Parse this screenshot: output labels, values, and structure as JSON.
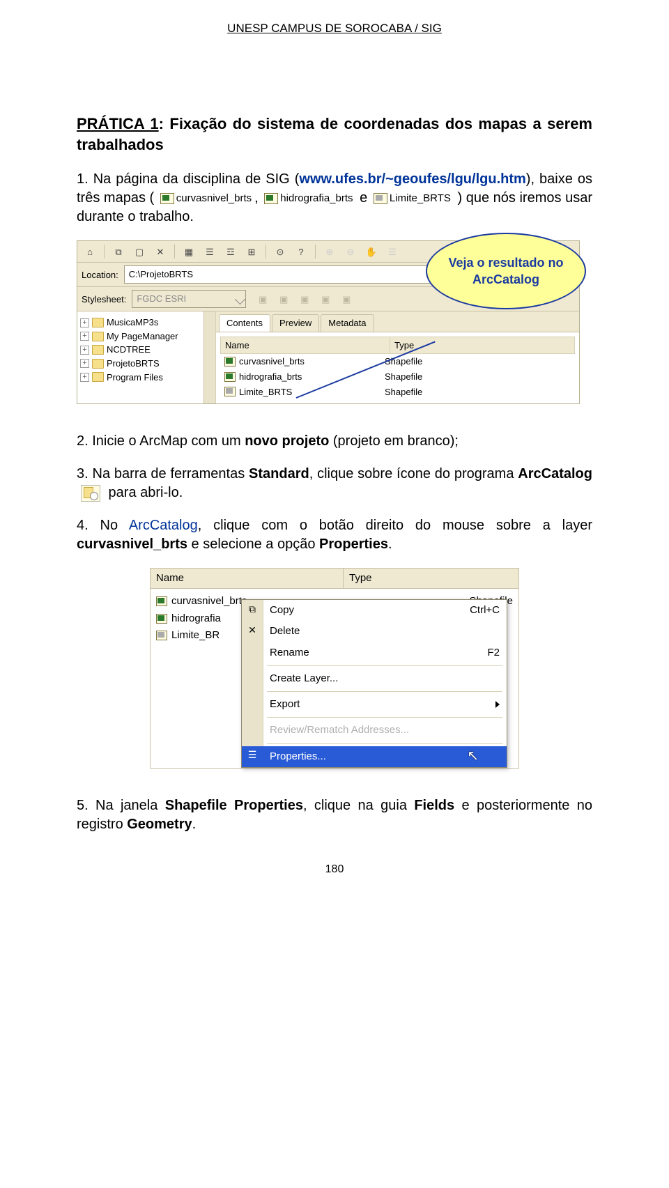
{
  "header": "UNESP CAMPUS DE SOROCABA / SIG",
  "title_label": "PRÁTICA 1",
  "title_rest": ": Fixação do sistema de coordenadas dos mapas a serem trabalhados",
  "p1_num": "1.",
  "p1_a": " Na página da disciplina de SIG (",
  "p1_link": "www.ufes.br/~geoufes/lgu/lgu.htm",
  "p1_b": "), baixe os três mapas (",
  "p1_sep": ", ",
  "p1_and": " e ",
  "p1_c": " ) que nós iremos usar durante o trabalho.",
  "shp_labels": {
    "curvas": "curvasnivel_brts",
    "hidro": "hidrografia_brts",
    "limite": "Limite_BRTS"
  },
  "arccat": {
    "location_label": "Location:",
    "location_value": "C:\\ProjetoBRTS",
    "stylesheet_label": "Stylesheet:",
    "stylesheet_value": "FGDC ESRI",
    "tree": [
      "MusicaMP3s",
      "My PageManager",
      "NCDTREE",
      "ProjetoBRTS",
      "Program Files"
    ],
    "tabs": [
      "Contents",
      "Preview",
      "Metadata"
    ],
    "col_name": "Name",
    "col_type": "Type",
    "rows": [
      {
        "name": "curvasnivel_brts",
        "type": "Shapefile"
      },
      {
        "name": "hidrografia_brts",
        "type": "Shapefile"
      },
      {
        "name": "Limite_BRTS",
        "type": "Shapefile"
      }
    ],
    "callout": "Veja o resultado no ArcCatalog"
  },
  "p2_num": "2.",
  "p2": " Inicie o ArcMap com um ",
  "p2_b": "novo projeto",
  "p2_c": " (projeto em branco);",
  "p3_num": "3.",
  "p3_a": " Na barra de ferramentas ",
  "p3_std": "Standard",
  "p3_b": ", clique sobre ícone do programa ",
  "p3_ac": "ArcCatalog",
  "p3_c": " para abri-lo.",
  "p4_num": "4.",
  "p4_a": " No ",
  "p4_ac": "ArcCatalog",
  "p4_b": ", clique com o botão direito do mouse sobre a layer ",
  "p4_layer": "curvasnivel_brts",
  "p4_c": " e selecione a opção ",
  "p4_prop": "Properties",
  "p4_d": ".",
  "context": {
    "col_name": "Name",
    "col_type": "Type",
    "left_rows": [
      "curvasnivel_brts",
      "hidrografia_brts",
      "Limite_BRTS"
    ],
    "left_types": [
      "Shapefile",
      "",
      ""
    ],
    "menu": [
      {
        "label": "Copy",
        "short": "Ctrl+C",
        "icon": "copy"
      },
      {
        "label": "Delete",
        "short": "",
        "icon": "delete"
      },
      {
        "label": "Rename",
        "short": "F2",
        "icon": ""
      },
      {
        "label": "Create Layer...",
        "short": "",
        "icon": ""
      },
      {
        "label": "Export",
        "short": "",
        "icon": "",
        "arrow": true
      },
      {
        "label": "Review/Rematch Addresses...",
        "short": "",
        "icon": "",
        "disabled": true
      },
      {
        "label": "Properties...",
        "short": "",
        "icon": "properties",
        "selected": true
      }
    ]
  },
  "p5_num": "5.",
  "p5_a": " Na janela ",
  "p5_win": "Shapefile Properties",
  "p5_b": ", clique na guia ",
  "p5_tab": "Fields",
  "p5_c": " e posteriormente no registro ",
  "p5_reg": "Geometry",
  "p5_d": ".",
  "page_number": "180"
}
